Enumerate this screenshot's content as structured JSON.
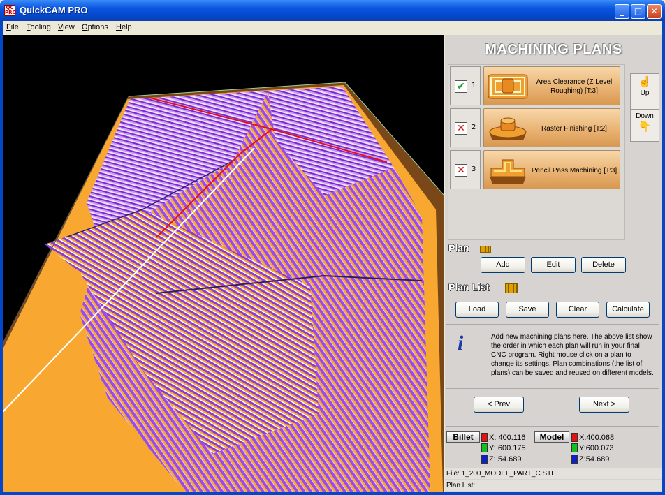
{
  "window": {
    "title": "QuickCAM PRO",
    "icon_text": "QC PRO",
    "minimize": "_",
    "maximize": "□",
    "close": "✕"
  },
  "menu": [
    "File",
    "Tooling",
    "View",
    "Options",
    "Help"
  ],
  "panel": {
    "title": "MACHINING PLANS",
    "plans": [
      {
        "num": "1",
        "checked": "✔",
        "label": "Area Clearance (Z Level Roughing) [T:3]"
      },
      {
        "num": "2",
        "checked": "✕",
        "label": "Raster Finishing [T:2]"
      },
      {
        "num": "3",
        "checked": "✕",
        "label": "Pencil Pass Machining [T:3]"
      }
    ],
    "up_label": "Up",
    "down_label": "Down",
    "plan_section": "Plan",
    "plan_buttons": {
      "add": "Add",
      "edit": "Edit",
      "delete": "Delete"
    },
    "planlist_section": "Plan List",
    "planlist_buttons": {
      "load": "Load",
      "save": "Save",
      "clear": "Clear",
      "calculate": "Calculate"
    },
    "info_icon": "i",
    "info_text": "Add new machining plans here. The above list show the order in which each plan will run in your final CNC program. Right mouse click on a plan to change its settings. Plan combinations (the list of plans) can be saved and reused on different models.",
    "prev": "< Prev",
    "next": "Next >"
  },
  "billet": {
    "label": "Billet",
    "x": "X: 400.116",
    "y": "Y: 600.175",
    "z": "Z: 54.689"
  },
  "model": {
    "label": "Model",
    "x": "X:400.068",
    "y": "Y:600.073",
    "z": "Z:54.689"
  },
  "status": {
    "file": "File: 1_200_MODEL_PART_C.STL",
    "plan_list": "Plan List:"
  },
  "colors": {
    "toolpath_purple": "#9a4ae8",
    "toolpath_light": "#d8b8f8",
    "model_orange": "#f8a830",
    "path_red": "#e81010"
  }
}
